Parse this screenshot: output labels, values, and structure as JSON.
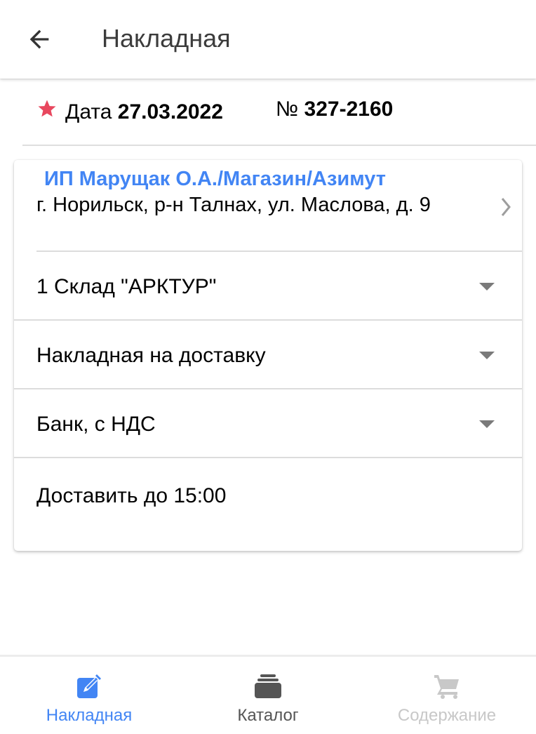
{
  "topbar": {
    "title": "Накладная",
    "back_icon": "arrow-left-icon"
  },
  "document": {
    "date_label": "Дата",
    "date_value": "27.03.2022",
    "number_label": "№",
    "number_value": "327-2160",
    "required_icon": "star-icon",
    "required_color": "#e8475e"
  },
  "client": {
    "name": "ИП Марущак О.А./Магазин/Азимут",
    "address": "г. Норильск, р-н Талнах, ул. Маслова, д. 9",
    "name_color": "#4285f4"
  },
  "fields": {
    "warehouse": "1 Склад \"АРКТУР\"",
    "document_type": "Накладная на доставку",
    "payment": "Банк, с НДС",
    "note": "Доставить до 15:00"
  },
  "bottom_nav": {
    "items": [
      {
        "label": "Накладная",
        "icon": "edit-document-icon",
        "state": "active",
        "color": "#4285f4"
      },
      {
        "label": "Каталог",
        "icon": "catalog-stack-icon",
        "state": "normal",
        "color": "#555555"
      },
      {
        "label": "Содержание",
        "icon": "cart-icon",
        "state": "disabled",
        "color": "#c8c8c8"
      }
    ]
  }
}
